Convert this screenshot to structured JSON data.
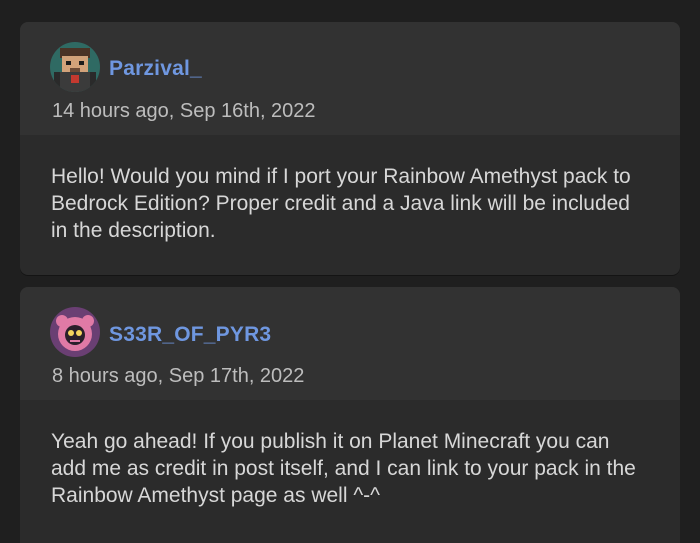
{
  "comments": [
    {
      "username": "Parzival_",
      "timestamp": "14 hours ago, Sep 16th, 2022",
      "body": "Hello! Would you mind if I port your Rainbow Amethyst pack to Bedrock Edition? Proper credit and a Java link will be included in the description.",
      "avatar_icon": "pixel-character-avatar"
    },
    {
      "username": "S33R_OF_PYR3",
      "timestamp": "8 hours ago, Sep 17th, 2022",
      "body": "Yeah go ahead! If you publish it on Planet Minecraft you can add me as credit in post itself, and I can link to your pack in the Rainbow Amethyst page as well ^-^",
      "avatar_icon": "pink-creature-avatar"
    }
  ],
  "colors": {
    "username": "#6f97e0",
    "card_bg": "#2b2b2b",
    "header_bg": "#323232",
    "page_bg": "#1f1f1f"
  }
}
